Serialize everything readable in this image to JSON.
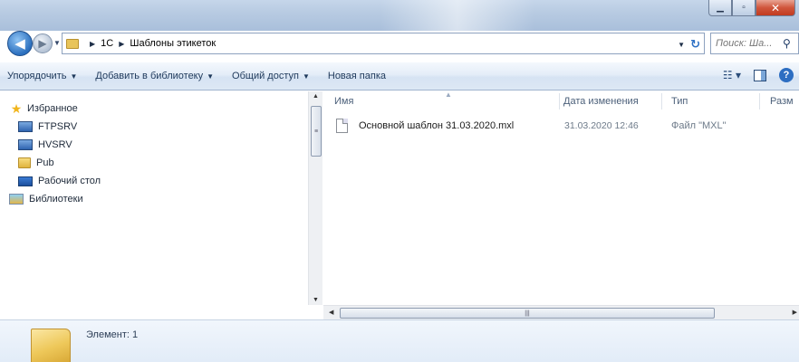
{
  "nav": {
    "back_icon": "back-arrow-icon",
    "forward_icon": "forward-arrow-icon"
  },
  "address": {
    "crumbs": [
      "1С",
      "Шаблоны этикеток"
    ]
  },
  "search": {
    "placeholder": "Поиск: Ша..."
  },
  "toolbar": {
    "organize": "Упорядочить",
    "add_to_library": "Добавить в библиотеку",
    "share": "Общий доступ",
    "new_folder": "Новая папка"
  },
  "sidebar": {
    "favorites": "Избранное",
    "items": [
      {
        "label": "FTPSRV",
        "icon": "network-computer-icon"
      },
      {
        "label": "HVSRV",
        "icon": "network-computer-icon"
      },
      {
        "label": "Pub",
        "icon": "folder-icon"
      },
      {
        "label": "Рабочий стол",
        "icon": "desktop-icon"
      },
      {
        "label": "Библиотеки",
        "icon": "library-icon"
      }
    ]
  },
  "columns": {
    "name": "Имя",
    "date": "Дата изменения",
    "type": "Тип",
    "size": "Разм"
  },
  "files": [
    {
      "name": "Основной шаблон 31.03.2020.mxl",
      "date": "31.03.2020 12:46",
      "type": "Файл \"MXL\""
    }
  ],
  "details": {
    "text": "Элемент: 1"
  }
}
